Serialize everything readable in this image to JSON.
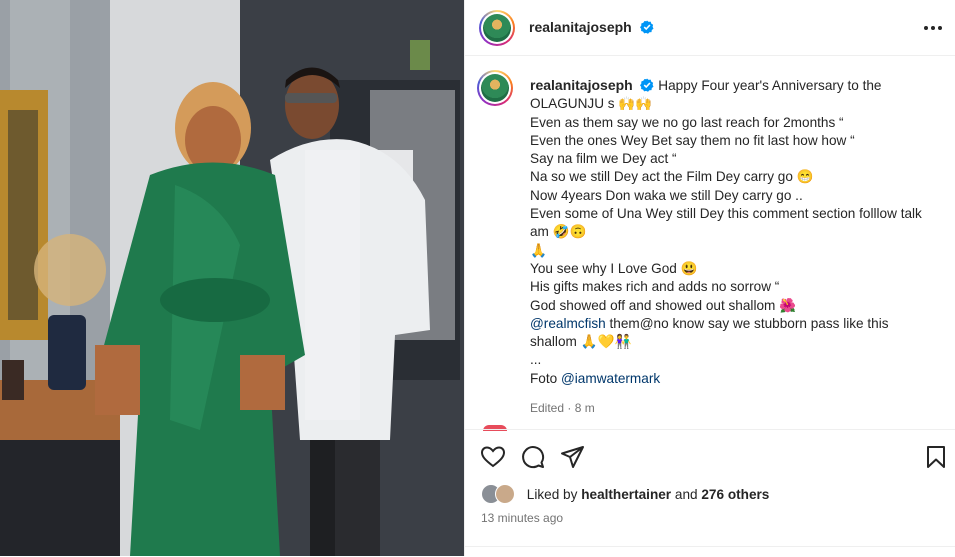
{
  "post": {
    "username": "realanitajoseph",
    "caption_lines": [
      "Happy Four year's Anniversary to the",
      "OLAGUNJU s 🙌🙌",
      "Even as them say we no go last reach for 2months “",
      "Even the ones Wey Bet say them no fit last how how “",
      "Say na film we Dey act “",
      "Na so we still Dey act the Film Dey carry go 😁",
      "Now 4years Don waka we still Dey carry go ..",
      "Even some of Una Wey still Dey this comment section folllow talk",
      "am 🤣🙃",
      "🙏",
      "You see why I Love God 😃",
      "His gifts makes rich and adds no sorrow “",
      "God showed off and showed out shallom 🌺",
      "them@no know say we stubborn pass like this",
      "shallom 🙏💛👫",
      "...",
      "Foto"
    ],
    "mention_realmcfish": "@realmcfish",
    "mention_photographer": "@iamwatermark",
    "edited_meta": "Edited · 8 m",
    "liked_by_prefix": "Liked by",
    "liked_by_user": "healthertainer",
    "liked_by_and": "and",
    "others": "276 others",
    "timestamp": "13 minutes ago"
  },
  "icons": [
    "verified-badge-icon",
    "more-options-icon",
    "heart-icon",
    "comment-icon",
    "share-icon",
    "bookmark-icon"
  ],
  "colors": {
    "verified": "#0095f6",
    "mention": "#00376b",
    "muted": "#737373",
    "dress": "#1f7a4d"
  }
}
